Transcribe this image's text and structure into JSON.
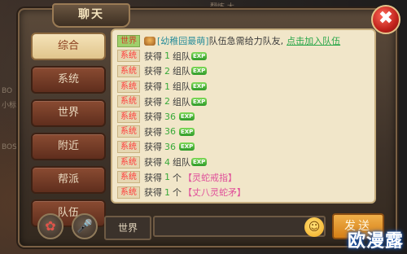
{
  "panel": {
    "title": "聊天",
    "close_label": "✖"
  },
  "background": {
    "left_labels": [
      "BO",
      "小标",
      "BOS"
    ],
    "top_label": "翻炼 大"
  },
  "tabs": [
    {
      "label": "综合",
      "active": true
    },
    {
      "label": "系统",
      "active": false
    },
    {
      "label": "世界",
      "active": false
    },
    {
      "label": "附近",
      "active": false
    },
    {
      "label": "帮派",
      "active": false
    },
    {
      "label": "队伍",
      "active": false
    }
  ],
  "messages": [
    {
      "channel": "世界",
      "speaker": "[幼稚园最萌]",
      "text": "队伍急需给力队友,",
      "link": "点击加入队伍"
    },
    {
      "channel": "系统",
      "prefix": "获得",
      "num": "1",
      "unit": "组队",
      "exp": "EXP"
    },
    {
      "channel": "系统",
      "prefix": "获得",
      "num": "2",
      "unit": "组队",
      "exp": "EXP"
    },
    {
      "channel": "系统",
      "prefix": "获得",
      "num": "1",
      "unit": "组队",
      "exp": "EXP"
    },
    {
      "channel": "系统",
      "prefix": "获得",
      "num": "2",
      "unit": "组队",
      "exp": "EXP"
    },
    {
      "channel": "系统",
      "prefix": "获得",
      "num": "36",
      "unit": "",
      "exp": "EXP"
    },
    {
      "channel": "系统",
      "prefix": "获得",
      "num": "36",
      "unit": "",
      "exp": "EXP"
    },
    {
      "channel": "系统",
      "prefix": "获得",
      "num": "36",
      "unit": "",
      "exp": "EXP"
    },
    {
      "channel": "系统",
      "prefix": "获得",
      "num": "4",
      "unit": "组队",
      "exp": "EXP"
    },
    {
      "channel": "系统",
      "prefix": "获得",
      "num": "1",
      "unit": "个",
      "item": "【灵蛇戒指】"
    },
    {
      "channel": "系统",
      "prefix": "获得",
      "num": "1",
      "unit": "个",
      "item": "【丈八灵蛇矛】"
    }
  ],
  "bottom_bar": {
    "bag_icon": "✿",
    "mic_icon": "🎤",
    "channel_label": "世界",
    "input_value": "",
    "emoji_icon": "☺",
    "send_label": "发送"
  },
  "watermark": "欧漫露"
}
